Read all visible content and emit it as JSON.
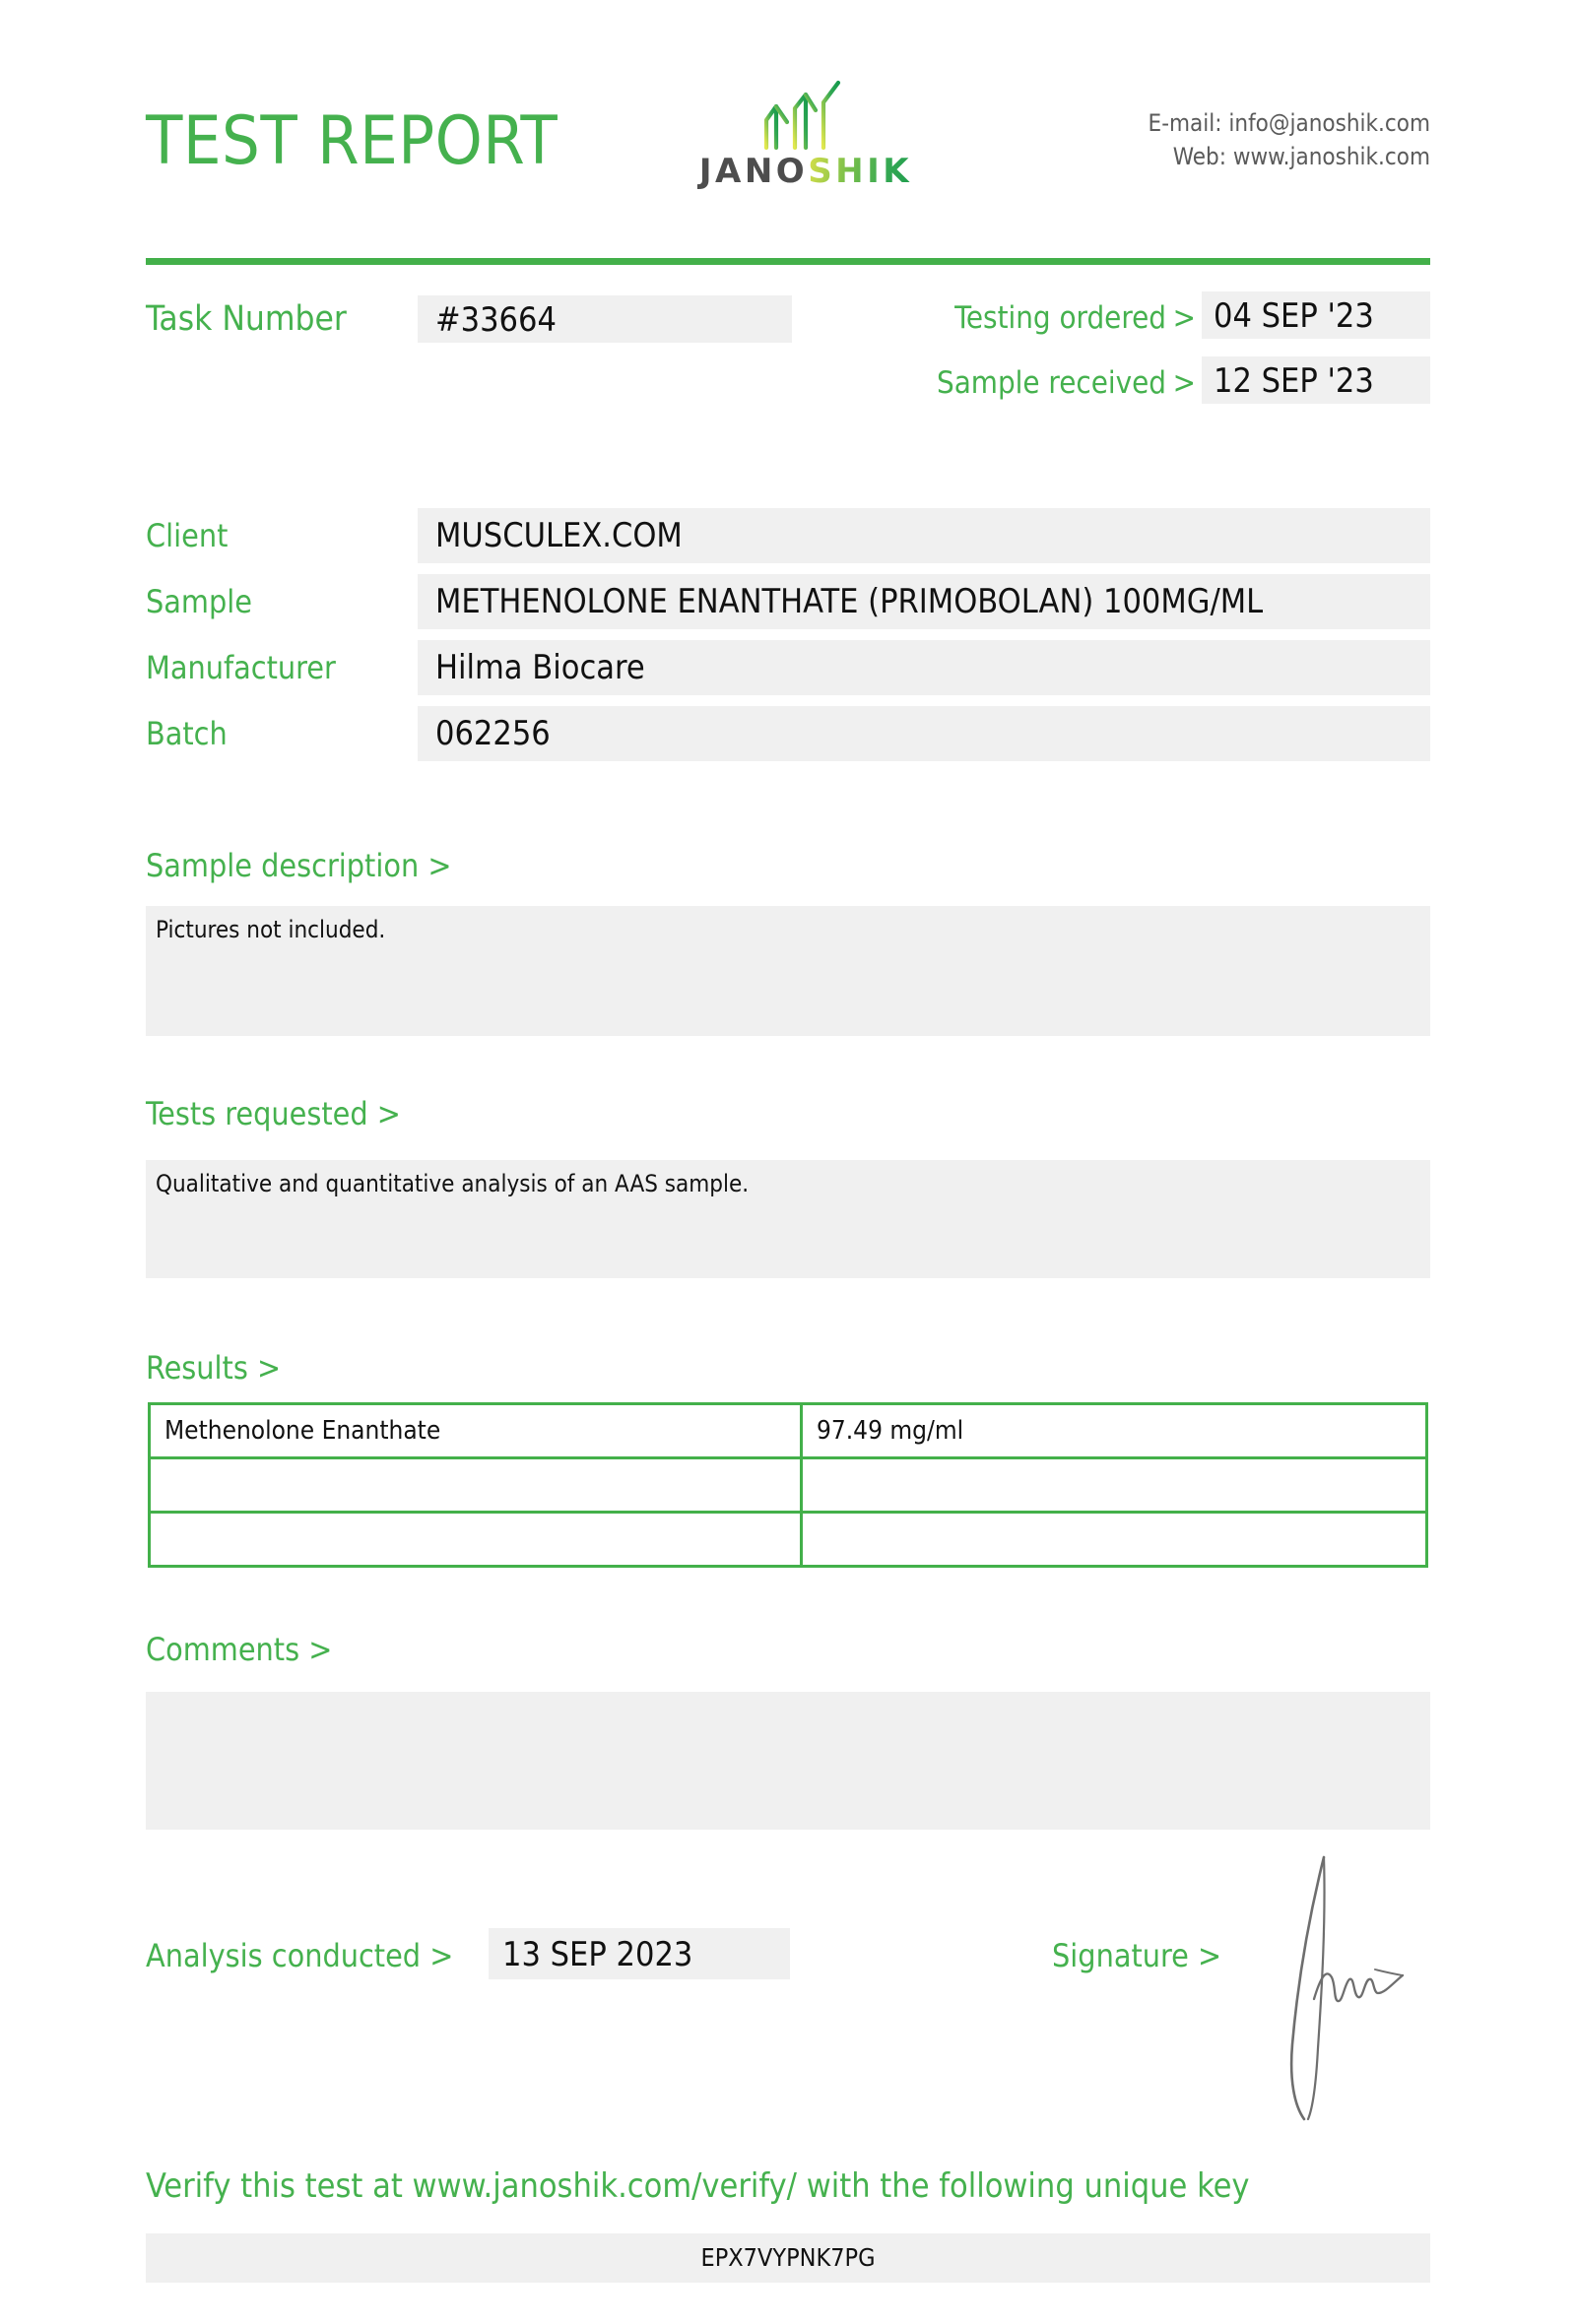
{
  "header": {
    "title": "TEST REPORT",
    "logo": {
      "mark": "ascending-peaks-icon",
      "word_dark": "JANO",
      "word_green": "SHIK"
    },
    "contact": {
      "email_line": "E-mail: info@janoshik.com",
      "web_line": "Web: www.janoshik.com"
    }
  },
  "task": {
    "label": "Task Number",
    "value": "#33664"
  },
  "dates": {
    "ordered_label": "Testing ordered",
    "ordered_gt": ">",
    "ordered_value": "04 SEP '23",
    "received_label": "Sample received",
    "received_gt": ">",
    "received_value": "12 SEP '23"
  },
  "fields": [
    {
      "label": "Client",
      "value": "MUSCULEX.COM"
    },
    {
      "label": "Sample",
      "value": "METHENOLONE ENANTHATE (PRIMOBOLAN) 100MG/ML"
    },
    {
      "label": "Manufacturer",
      "value": "Hilma Biocare"
    },
    {
      "label": "Batch",
      "value": "062256"
    }
  ],
  "sample_description": {
    "heading": "Sample description >",
    "text": "Pictures not included."
  },
  "tests_requested": {
    "heading": "Tests requested >",
    "text": "Qualitative and quantitative analysis of an AAS sample."
  },
  "results": {
    "heading": "Results >",
    "rows": [
      {
        "name": "Methenolone Enanthate",
        "value": "97.49 mg/ml"
      },
      {
        "name": "",
        "value": ""
      },
      {
        "name": "",
        "value": ""
      }
    ]
  },
  "comments": {
    "heading": "Comments >",
    "text": ""
  },
  "analysis": {
    "label": "Analysis conducted >",
    "value": "13 SEP 2023"
  },
  "signature": {
    "label": "Signature >",
    "mark": "handwritten-signature"
  },
  "verify": {
    "text": "Verify this test at www.janoshik.com/verify/ with the following unique key",
    "key": "EPX7VYPNK7PG"
  },
  "colors": {
    "brand_green": "#45b14e",
    "rule_green": "#43b04a",
    "panel_gray": "#f0f0f0",
    "logo_dark": "#4d4d4d"
  }
}
